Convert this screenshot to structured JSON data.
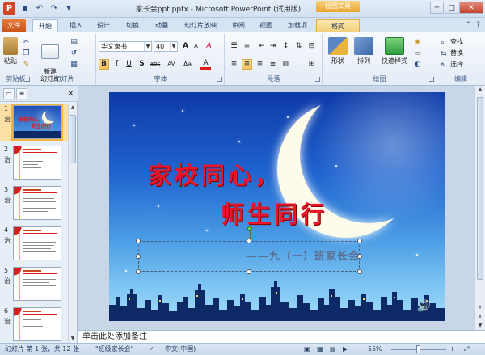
{
  "app": {
    "logo": "P",
    "window_title": "家长会ppt.pptx - Microsoft PowerPoint (试用版)",
    "context_tab_group": "绘图工具",
    "qat_icons": [
      "save-icon",
      "undo-icon",
      "redo-icon",
      "customize-icon"
    ],
    "window_controls": {
      "min": "─",
      "max": "□",
      "close": "✕"
    }
  },
  "tabs": [
    "文件",
    "开始",
    "插入",
    "设计",
    "切换",
    "动画",
    "幻灯片放映",
    "审阅",
    "视图",
    "加载项",
    "格式"
  ],
  "ribbon": {
    "clipboard": {
      "paste": "粘贴",
      "label": "剪贴板"
    },
    "slides": {
      "new_slide": "新建\n幻灯片",
      "label": "幻灯片"
    },
    "font": {
      "font_name": "华文隶书",
      "font_size": "40",
      "grow": "A",
      "shrink": "A",
      "clear": "A",
      "bold": "B",
      "italic": "I",
      "underline": "U",
      "shadow": "S",
      "strike": "abc",
      "spacing": "AV",
      "case": "Aa",
      "color": "A",
      "label": "字体"
    },
    "paragraph": {
      "label": "段落"
    },
    "drawing": {
      "shape": "形状",
      "arrange": "排列",
      "quick_styles": "快速样式",
      "label": "绘图"
    },
    "editing": {
      "find": "查找",
      "replace": "替换",
      "select": "选择",
      "label": "编辑"
    }
  },
  "slide_pane": {
    "slides": [
      {
        "num": "1",
        "title_line1": "家校同心，",
        "title_line2": "师生同行"
      },
      {
        "num": "2"
      },
      {
        "num": "3"
      },
      {
        "num": "4"
      },
      {
        "num": "5"
      },
      {
        "num": "6"
      }
    ],
    "slide_marker": "治"
  },
  "slide": {
    "title_line1": "家校同心，",
    "title_line2": "师生同行",
    "subtitle": "——九（一）班家长会",
    "speaker_icon": "speaker-icon"
  },
  "notes": {
    "placeholder": "单击此处添加备注"
  },
  "status": {
    "slide_info": "幻灯片 第 1 张，共 12 张",
    "theme": "\"班级家长会\"",
    "language": "中文(中国)",
    "zoom": "55%",
    "zoom_minus": "−",
    "zoom_plus": "+"
  },
  "colors": {
    "title_red": "#e8162a",
    "file_tab": "#d24726",
    "context_tab": "#f3cf77",
    "accent": "#2d4f83"
  }
}
